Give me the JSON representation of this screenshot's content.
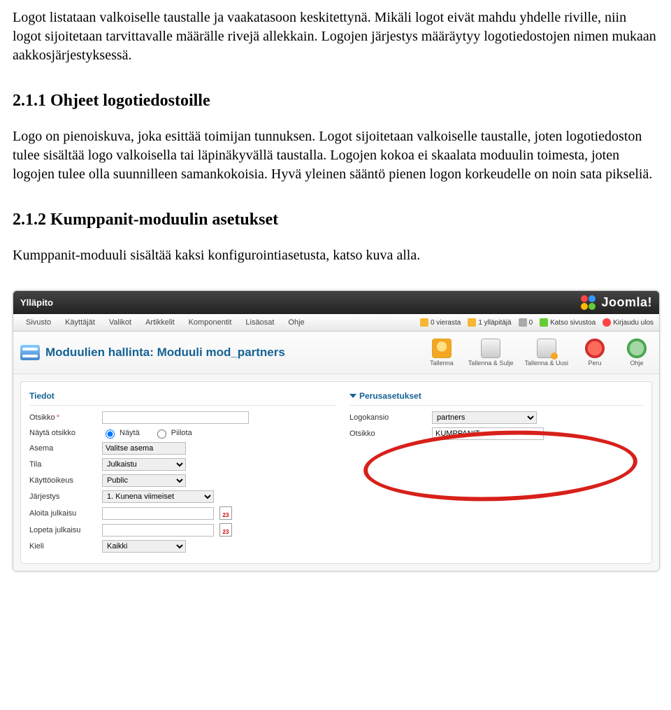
{
  "doc": {
    "p1": "Logot listataan valkoiselle taustalle ja vaakatasoon keskitettynä. Mikäli logot eivät mahdu yhdelle riville, niin logot sijoitetaan tarvittavalle määrälle rivejä allekkain. Logojen järjestys määräytyy logotiedostojen nimen mukaan aakkosjärjestyksessä.",
    "h211": "2.1.1 Ohjeet logotiedostoille",
    "p2": "Logo on pienoiskuva, joka esittää toimijan tunnuksen. Logot sijoitetaan valkoiselle taustalle, joten logotiedoston tulee sisältää logo valkoisella tai läpinäkyvällä taustalla. Logojen kokoa ei skaalata moduulin toimesta, joten logojen tulee olla suunnilleen samankokoisia. Hyvä yleinen sääntö pienen logon korkeudelle on noin sata pikseliä.",
    "h212": "2.1.2 Kumppanit-moduulin asetukset",
    "p3": "Kumppanit-moduuli sisältää kaksi konfigurointiasetusta, katso kuva alla."
  },
  "ui": {
    "admin_title": "Ylläpito",
    "brand": "Joomla!",
    "menu": [
      "Sivusto",
      "Käyttäjät",
      "Valikot",
      "Artikkelit",
      "Komponentit",
      "Lisäosat",
      "Ohje"
    ],
    "stats": {
      "guests": "0 vierasta",
      "admins": "1 ylläpitäjä",
      "mail": "0",
      "view": "Katso sivustoa",
      "logout": "Kirjaudu ulos"
    },
    "page_title": "Moduulien hallinta: Moduuli mod_partners",
    "toolbar": {
      "save": "Tallenna",
      "saveclose": "Tallenna & Sulje",
      "savenew": "Tallenna & Uusi",
      "cancel": "Peru",
      "help": "Ohje"
    },
    "left": {
      "legend": "Tiedot",
      "otsikko": "Otsikko",
      "otsikko_val": "",
      "nayta_otsikko": "Näytä otsikko",
      "nayta": "Näytä",
      "piilota": "Piilota",
      "asema": "Asema",
      "asema_val": "Valitse asema",
      "tila": "Tila",
      "tila_val": "Julkaistu",
      "oikeus": "Käyttöoikeus",
      "oikeus_val": "Public",
      "jarjestys": "Järjestys",
      "jarjestys_val": "1. Kunena viimeiset",
      "aloita": "Aloita julkaisu",
      "aloita_val": "",
      "lopeta": "Lopeta julkaisu",
      "lopeta_val": "",
      "kieli": "Kieli",
      "kieli_val": "Kaikki",
      "cal": "23"
    },
    "right": {
      "legend": "Perusasetukset",
      "logokansio": "Logokansio",
      "logokansio_val": "partners",
      "otsikko": "Otsikko",
      "otsikko_val": "KUMPPANIT"
    }
  }
}
